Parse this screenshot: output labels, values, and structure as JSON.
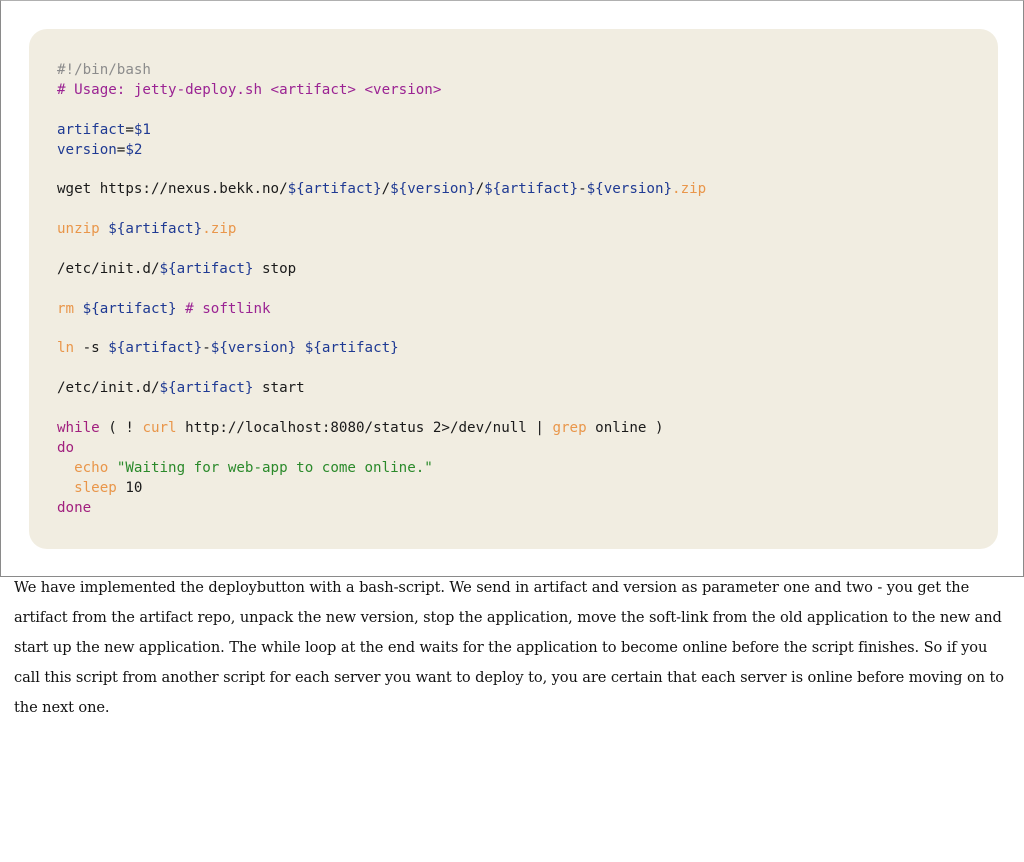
{
  "code_block": {
    "language": "bash",
    "lines": [
      [
        {
          "t": "#!/bin/bash",
          "c": "shebang"
        }
      ],
      [
        {
          "t": "# Usage: jetty-deploy.sh <artifact> <version>",
          "c": "comment"
        }
      ],
      [],
      [
        {
          "t": "artifact",
          "c": "var"
        },
        {
          "t": "=",
          "c": "plain"
        },
        {
          "t": "$1",
          "c": "var"
        }
      ],
      [
        {
          "t": "version",
          "c": "var"
        },
        {
          "t": "=",
          "c": "plain"
        },
        {
          "t": "$2",
          "c": "var"
        }
      ],
      [],
      [
        {
          "t": "wget https://nexus.bekk.no/",
          "c": "plain"
        },
        {
          "t": "${artifact}",
          "c": "var"
        },
        {
          "t": "/",
          "c": "plain"
        },
        {
          "t": "${version}",
          "c": "var"
        },
        {
          "t": "/",
          "c": "plain"
        },
        {
          "t": "${artifact}",
          "c": "var"
        },
        {
          "t": "-",
          "c": "plain"
        },
        {
          "t": "${version}",
          "c": "var"
        },
        {
          "t": ".zip",
          "c": "cmd"
        }
      ],
      [],
      [
        {
          "t": "unzip",
          "c": "cmd"
        },
        {
          "t": " ",
          "c": "plain"
        },
        {
          "t": "${artifact}",
          "c": "var"
        },
        {
          "t": ".zip",
          "c": "cmd"
        }
      ],
      [],
      [
        {
          "t": "/etc/init.d/",
          "c": "plain"
        },
        {
          "t": "${artifact}",
          "c": "var"
        },
        {
          "t": " stop",
          "c": "plain"
        }
      ],
      [],
      [
        {
          "t": "rm",
          "c": "cmd"
        },
        {
          "t": " ",
          "c": "plain"
        },
        {
          "t": "${artifact}",
          "c": "var"
        },
        {
          "t": " ",
          "c": "plain"
        },
        {
          "t": "# softlink",
          "c": "comment"
        }
      ],
      [],
      [
        {
          "t": "ln",
          "c": "cmd"
        },
        {
          "t": " -s ",
          "c": "plain"
        },
        {
          "t": "${artifact}",
          "c": "var"
        },
        {
          "t": "-",
          "c": "plain"
        },
        {
          "t": "${version}",
          "c": "var"
        },
        {
          "t": " ",
          "c": "plain"
        },
        {
          "t": "${artifact}",
          "c": "var"
        }
      ],
      [],
      [
        {
          "t": "/etc/init.d/",
          "c": "plain"
        },
        {
          "t": "${artifact}",
          "c": "var"
        },
        {
          "t": " start",
          "c": "plain"
        }
      ],
      [],
      [
        {
          "t": "while",
          "c": "kw"
        },
        {
          "t": " ( ! ",
          "c": "plain"
        },
        {
          "t": "curl",
          "c": "cmd"
        },
        {
          "t": " http://localhost:8080/status 2>/dev/null | ",
          "c": "plain"
        },
        {
          "t": "grep",
          "c": "cmd"
        },
        {
          "t": " online )",
          "c": "plain"
        }
      ],
      [
        {
          "t": "do",
          "c": "kw"
        }
      ],
      [
        {
          "t": "  ",
          "c": "plain"
        },
        {
          "t": "echo",
          "c": "cmd"
        },
        {
          "t": " ",
          "c": "plain"
        },
        {
          "t": "\"Waiting for web-app to come online.\"",
          "c": "str"
        }
      ],
      [
        {
          "t": "  ",
          "c": "plain"
        },
        {
          "t": "sleep",
          "c": "cmd"
        },
        {
          "t": " 10",
          "c": "num"
        }
      ],
      [
        {
          "t": "done",
          "c": "kw"
        }
      ]
    ]
  },
  "description": "We have implemented the deploybutton with a bash-script. We send in artifact and version as parameter one and two - you get the artifact from the artifact repo, unpack the new version, stop the application, move the soft-link from the old application to the new and start up the new application. The while loop at the end waits for the application to become online before the script finishes. So if you call this script from another script for each server you want to deploy to, you are certain that each server is online before moving on to the next one."
}
